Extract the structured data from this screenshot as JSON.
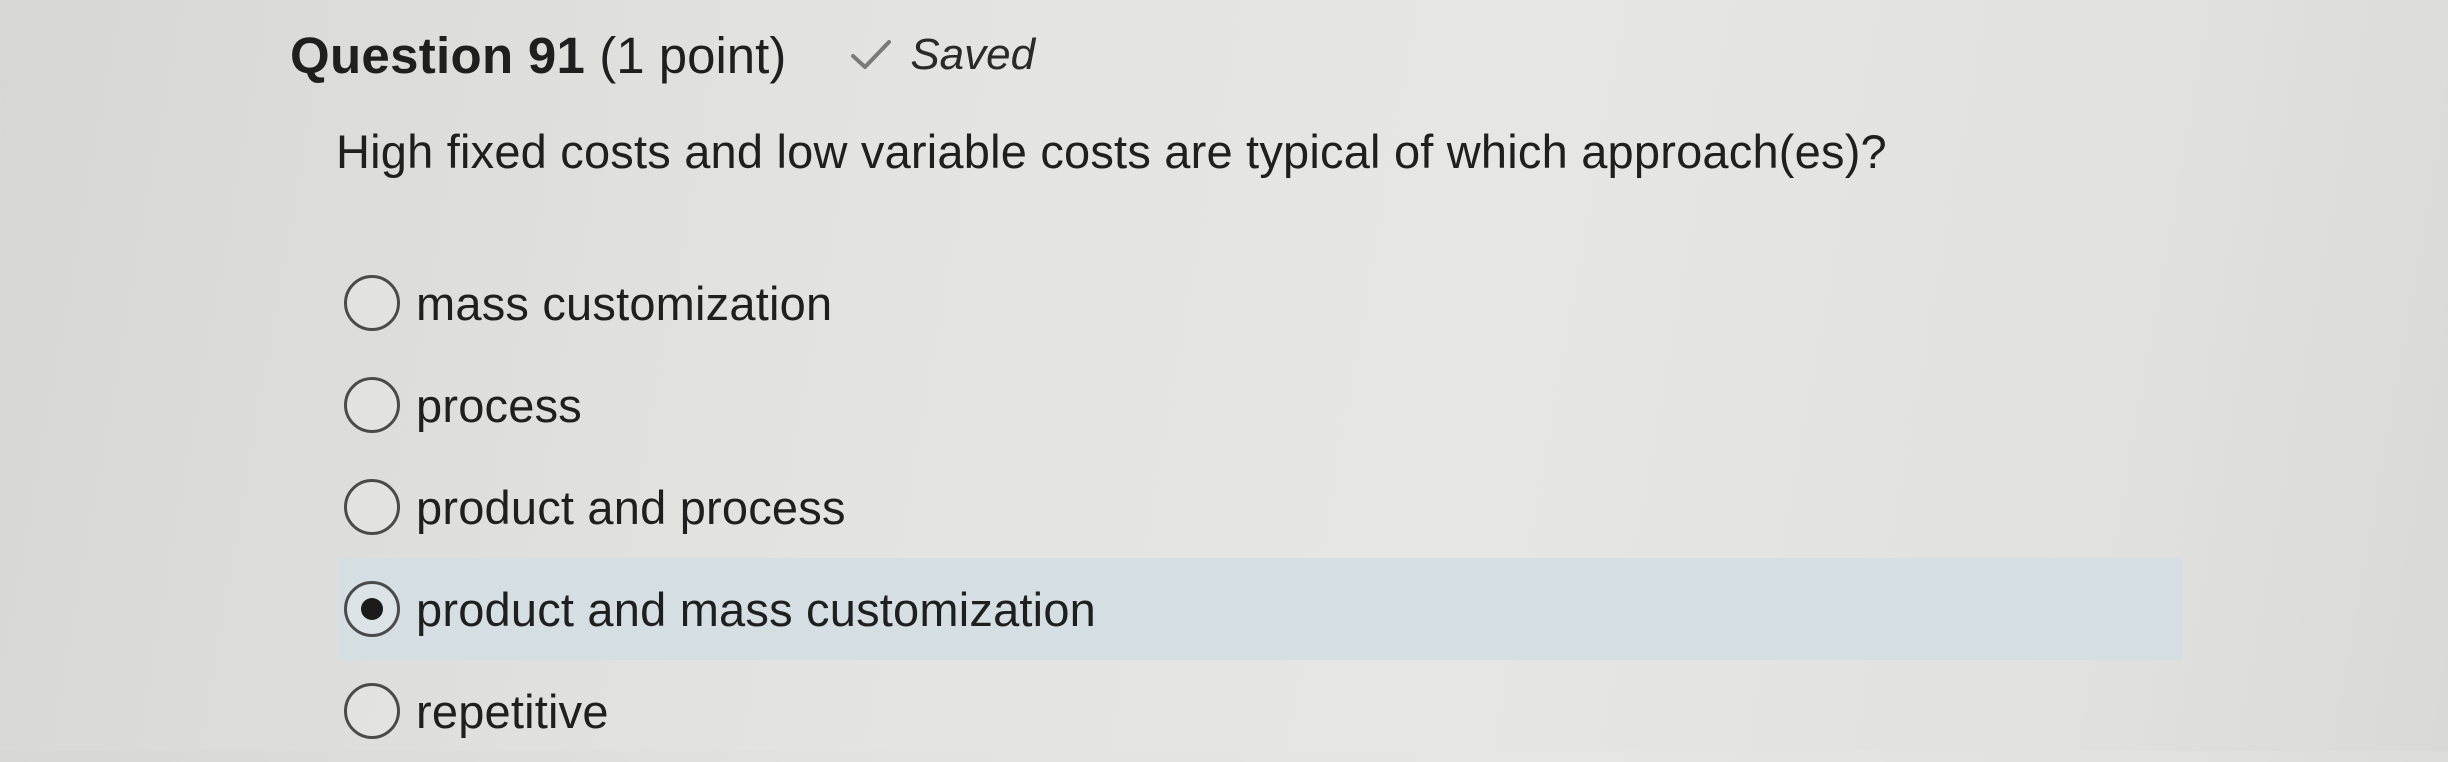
{
  "header": {
    "title": "Question 91",
    "points": "(1 point)",
    "status_icon": "check-icon",
    "status_text": "Saved"
  },
  "question": {
    "text": "High fixed costs and low variable costs are typical of which approach(es)?"
  },
  "options": [
    {
      "label": "mass customization",
      "selected": false
    },
    {
      "label": "process",
      "selected": false
    },
    {
      "label": "product and process",
      "selected": false
    },
    {
      "label": "product and mass customization",
      "selected": true
    },
    {
      "label": "repetitive",
      "selected": false
    }
  ],
  "colors": {
    "selected_row_bg": "#d5dee3",
    "text": "#1f1f1f"
  }
}
